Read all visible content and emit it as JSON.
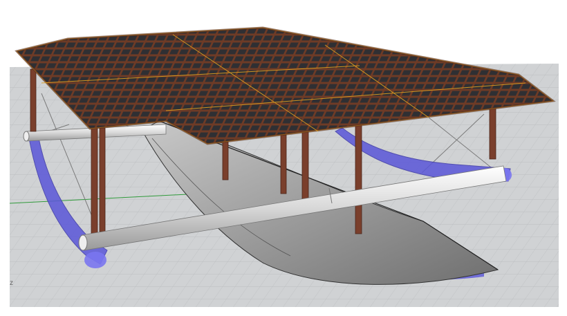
{
  "viewport": {
    "background_color": "#d0d2d4",
    "grid_line_color": "#b6b9bc",
    "grid_accent_color": "#2f9a3a",
    "axis_label": "Z"
  },
  "model": {
    "roof_color": "#6e3b26",
    "roof_panel_color": "#2f2f33",
    "roof_edge_color": "#e0a020",
    "post_color": "#7a3f2c",
    "boom_color": "#d8d8d8",
    "hull_color": "#8a8b8c",
    "float_color": "#5a56d8",
    "rigging_color": "#7b7b7b"
  }
}
